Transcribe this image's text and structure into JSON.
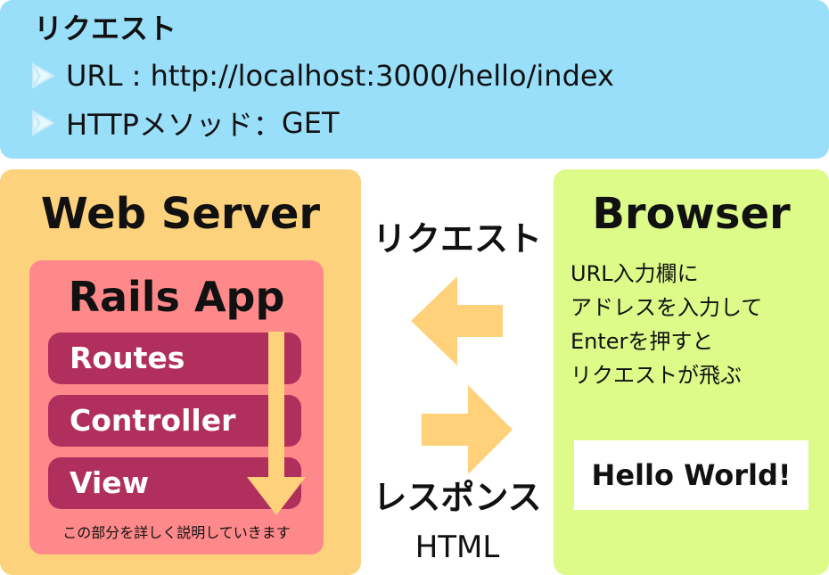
{
  "request_banner": {
    "heading": "リクエスト",
    "rows": [
      {
        "label": "URL",
        "separator": " : ",
        "value": "http://localhost:3000/hello/index"
      },
      {
        "label": "HTTPメソッド",
        "separator": "：",
        "value": "GET"
      }
    ]
  },
  "web_server": {
    "title": "Web Server",
    "rails_app": {
      "title": "Rails App",
      "components": [
        "Routes",
        "Controller",
        "View"
      ],
      "note": "この部分を詳しく説明していきます"
    }
  },
  "middle": {
    "request_label": "リクエスト",
    "response_label": "レスポンス",
    "response_format": "HTML"
  },
  "browser": {
    "title": "Browser",
    "description_lines": [
      "URL入力欄に",
      "アドレスを入力して",
      "Enterを押すと",
      "リクエストが飛ぶ"
    ],
    "rendered_text": "Hello World!"
  },
  "colors": {
    "request_banner": "#99dff9",
    "web_server": "#fdd27c",
    "rails_app": "#fe898a",
    "component": "#b12f5d",
    "browser": "#dcfb89",
    "arrow": "#fed17a"
  },
  "icons": {
    "bullet": "play-triangle-icon",
    "flow": "down-arrow-icon",
    "request": "left-arrow-icon",
    "response": "right-arrow-icon"
  }
}
